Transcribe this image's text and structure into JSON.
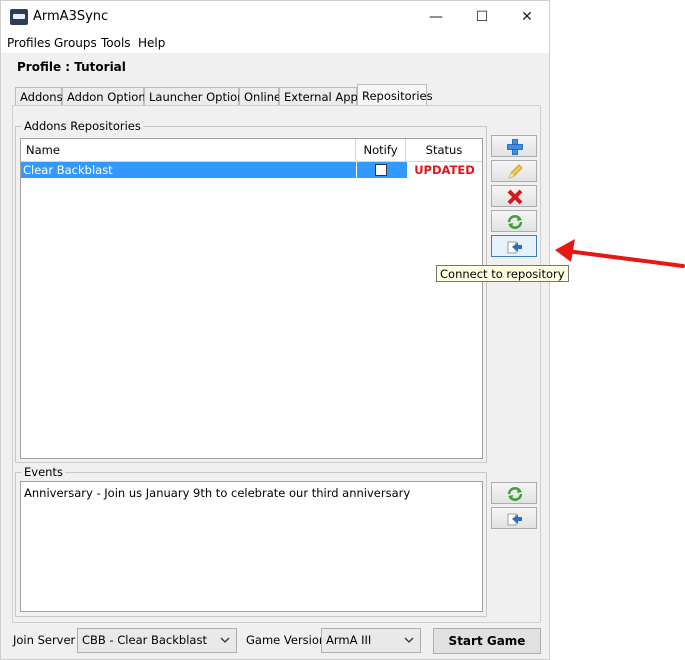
{
  "window": {
    "title": "ArmA3Sync",
    "controls": {
      "minimize": "—",
      "maximize": "☐",
      "close": "✕"
    }
  },
  "menu": [
    "Profiles",
    "Groups",
    "Tools",
    "Help"
  ],
  "profile_label": "Profile : Tutorial",
  "tabs": [
    {
      "label": "Addons",
      "active": false
    },
    {
      "label": "Addon Options",
      "active": false
    },
    {
      "label": "Launcher Options",
      "active": false
    },
    {
      "label": "Online",
      "active": false
    },
    {
      "label": "External Apps",
      "active": false
    },
    {
      "label": "Repositories",
      "active": true
    }
  ],
  "repositories": {
    "group_title": "Addons Repositories",
    "columns": [
      "Name",
      "Notify",
      "Status"
    ],
    "rows": [
      {
        "name": "Clear Backblast",
        "notify": false,
        "status": "UPDATED",
        "selected": true
      }
    ],
    "buttons": [
      {
        "name": "add-repository",
        "icon": "plus-icon"
      },
      {
        "name": "edit-repository",
        "icon": "pencil-icon"
      },
      {
        "name": "remove-repository",
        "icon": "red-x-icon"
      },
      {
        "name": "sync-repository",
        "icon": "sync-icon"
      },
      {
        "name": "connect-repository",
        "icon": "connect-icon"
      }
    ],
    "tooltip": "Connect to repository"
  },
  "events": {
    "group_title": "Events",
    "items": [
      "Anniversary - Join us January 9th to celebrate our third anniversary"
    ],
    "buttons": [
      {
        "name": "sync-events",
        "icon": "sync-icon"
      },
      {
        "name": "connect-events",
        "icon": "connect-icon"
      }
    ]
  },
  "bottom": {
    "join_server_label": "Join Server",
    "join_server_value": "CBB - Clear Backblast",
    "game_version_label": "Game Version",
    "game_version_value": "ArmA III",
    "start_button": "Start Game"
  },
  "colors": {
    "selection": "#3399ff",
    "status_updated": "#e0151b",
    "annotation_arrow": "#e8170f"
  }
}
